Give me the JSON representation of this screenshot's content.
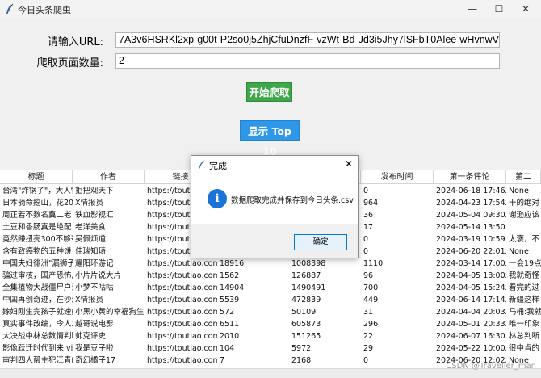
{
  "window": {
    "title": "今日头条爬虫",
    "minimize_glyph": "—",
    "maximize_glyph": "☐",
    "close_glyph": "✕"
  },
  "form": {
    "url_label": "请输入URL:",
    "url_value": "7A3v6HSRKl2xp-g00t-P2so0j5ZhjCfuDnzfF-vzWt-Bd-Jd3i5Jhy7lSFbT0Alee-wHvnwVxaptC",
    "pages_label": "爬取页面数量:",
    "pages_value": "2"
  },
  "buttons": {
    "start_label": "开始爬取",
    "top10_label": "显示 Top 10",
    "start_color": "#3fa64a",
    "top10_color": "#2f97e8"
  },
  "table": {
    "columns": [
      "标题",
      "作者",
      "链接",
      "",
      "",
      "发布时间",
      "第一条评论",
      "第二"
    ],
    "rows": [
      [
        "台湾\"炸锅了\"，大人物",
        "拒把观天下",
        "https://toutiao.com",
        "",
        "",
        "0",
        "2024-06-18 17:46发",
        "None"
      ],
      [
        "日本骑命挖山，花20",
        "X情报员",
        "https://toutiao.com",
        "",
        "",
        "964",
        "2024-04-23 17:54发",
        "干的绝对"
      ],
      [
        "周正若不数名冀二老",
        "铁血影视汇",
        "https://toutiao.com",
        "",
        "",
        "36",
        "2024-05-04 09:30发",
        "谢逊应该"
      ],
      [
        "土豆和香肠真是绝配",
        "老洋美食",
        "https://toutiao.com",
        "",
        "",
        "17",
        "2024-05-14 13:50发",
        ""
      ],
      [
        "竟然赚扭亮300不够辈",
        "吴佩烦道",
        "https://toutiao.com",
        "",
        "",
        "0",
        "2024-03-19 10:59发",
        "太褒，不"
      ],
      [
        "含有致癌物的五种饼",
        "佳瑞知琦",
        "https://toutiao.com",
        "",
        "",
        "0",
        "2024-06-20 22:01发",
        "None"
      ],
      [
        "中国夫妇徘洲\"漏狮子",
        "耀阳环游记",
        "https://toutiao.com",
        "18916",
        "1008398",
        "1110",
        "2024-03-14 17:00发",
        "一会19点"
      ],
      [
        "骗过审核，国产恐怖片",
        "小片片说大片",
        "https://toutiao.com",
        "1562",
        "126887",
        "96",
        "2024-04-05 18:00发",
        "我就奇怪"
      ],
      [
        "全集植物大战僵尸户沙",
        "小梦不咕咕",
        "https://toutiao.com",
        "14904",
        "1490491",
        "700",
        "2024-04-05 15:24发",
        "看完的过"
      ],
      [
        "中国再创奇迹，在沙漠",
        "X情报员",
        "https://toutiao.com",
        "5539",
        "472839",
        "449",
        "2024-06-14 17:14发",
        "新疆这样"
      ],
      [
        "嫁妇刚生完孩子就速娘",
        "小黑小黄的幸福狗生",
        "https://toutiao.com",
        "572",
        "50109",
        "31",
        "2024-04-04 20:03发",
        "马桶:我就"
      ],
      [
        "真实事件改编，令人发",
        "越哥说电影",
        "https://toutiao.com",
        "6511",
        "605873",
        "296",
        "2024-05-01 20:33发",
        "唯一印象"
      ],
      [
        "大决战中林总数情判断",
        "帅克评史",
        "https://toutiao.com",
        "2010",
        "151265",
        "22",
        "2024-06-07 16:30发",
        "林总判断"
      ],
      [
        "影像跃迁时代到来 vivo",
        "我是豆子啦",
        "https://toutiao.com",
        "104",
        "5972",
        "29",
        "2024-05-22 10:00发",
        "很中肯的"
      ],
      [
        "审判四人帮主犯江青的",
        "奇幻橘子17",
        "https://toutiao.com",
        "7",
        "2168",
        "0",
        "2024-06-20 12:02发",
        "None"
      ]
    ]
  },
  "dialog": {
    "title": "完成",
    "message": "数据爬取完成并保存到今日头条.csv",
    "ok_label": "确定",
    "close_glyph": "✕",
    "info_glyph": "i",
    "info_color": "#1a73d9"
  },
  "watermark": "CSDN @Traveller_man"
}
